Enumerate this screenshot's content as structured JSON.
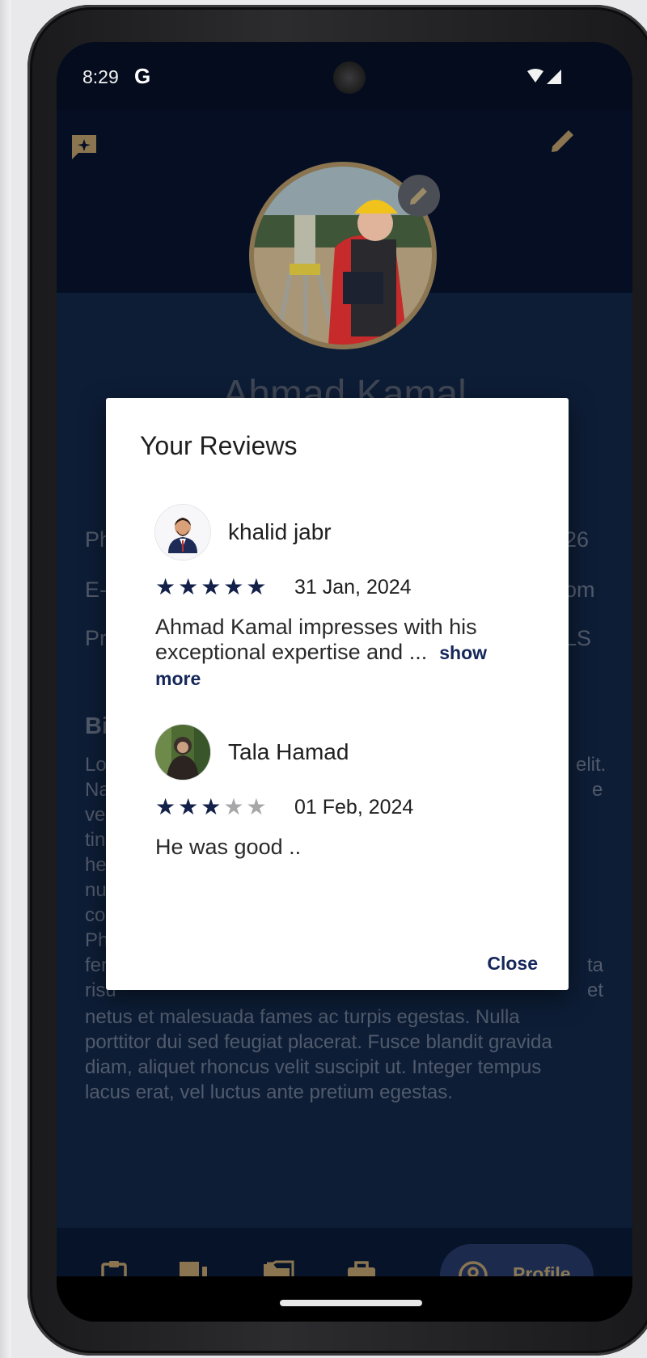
{
  "status_bar": {
    "time": "8:29",
    "g_logo": "G"
  },
  "profile_bg": {
    "name": "Ahmad Kamal",
    "rows": [
      {
        "left": "Ph",
        "right": "26"
      },
      {
        "left": "E-M",
        "right": "om"
      },
      {
        "left": "Pri",
        "right": "LS"
      }
    ],
    "bio_title": "Bi",
    "bio_left_fragments": [
      "Lor",
      "Na",
      "ves",
      "tin",
      "her",
      "nur",
      "cor",
      "Pha",
      "fer",
      "risu"
    ],
    "bio_right_fragments": [
      "elit.",
      "e",
      "",
      "",
      "",
      "",
      "",
      "",
      "ta",
      "et"
    ],
    "bio_tail": [
      "netus et malesuada fames ac turpis egestas. Nulla",
      "porttitor dui sed feugiat placerat. Fusce blandit gravida",
      "diam, aliquet rhoncus velit suscipit ut. Integer tempus",
      "lacus erat, vel luctus ante pretium egestas."
    ]
  },
  "dialog": {
    "title": "Your Reviews",
    "close_label": "Close",
    "reviews": [
      {
        "name": "khalid jabr",
        "rating": 5,
        "stars": "★★★★★",
        "date": "31 Jan, 2024",
        "text": "Ahmad Kamal impresses with his exceptional expertise and ...",
        "show_more": "show more"
      },
      {
        "name": "Tala Hamad",
        "rating": 3,
        "stars_on": "★★★",
        "stars_off": "★★",
        "date": "01 Feb, 2024",
        "text": "He was good .."
      }
    ]
  },
  "nav": {
    "items": [
      "clipboard-icon",
      "chat-icon",
      "folder-icon",
      "briefcase-icon",
      "profile-icon"
    ],
    "active_label": "Profile"
  },
  "colors": {
    "accent_navy": "#12204a",
    "gold": "#8a7550",
    "screen_bg": "#071329"
  }
}
